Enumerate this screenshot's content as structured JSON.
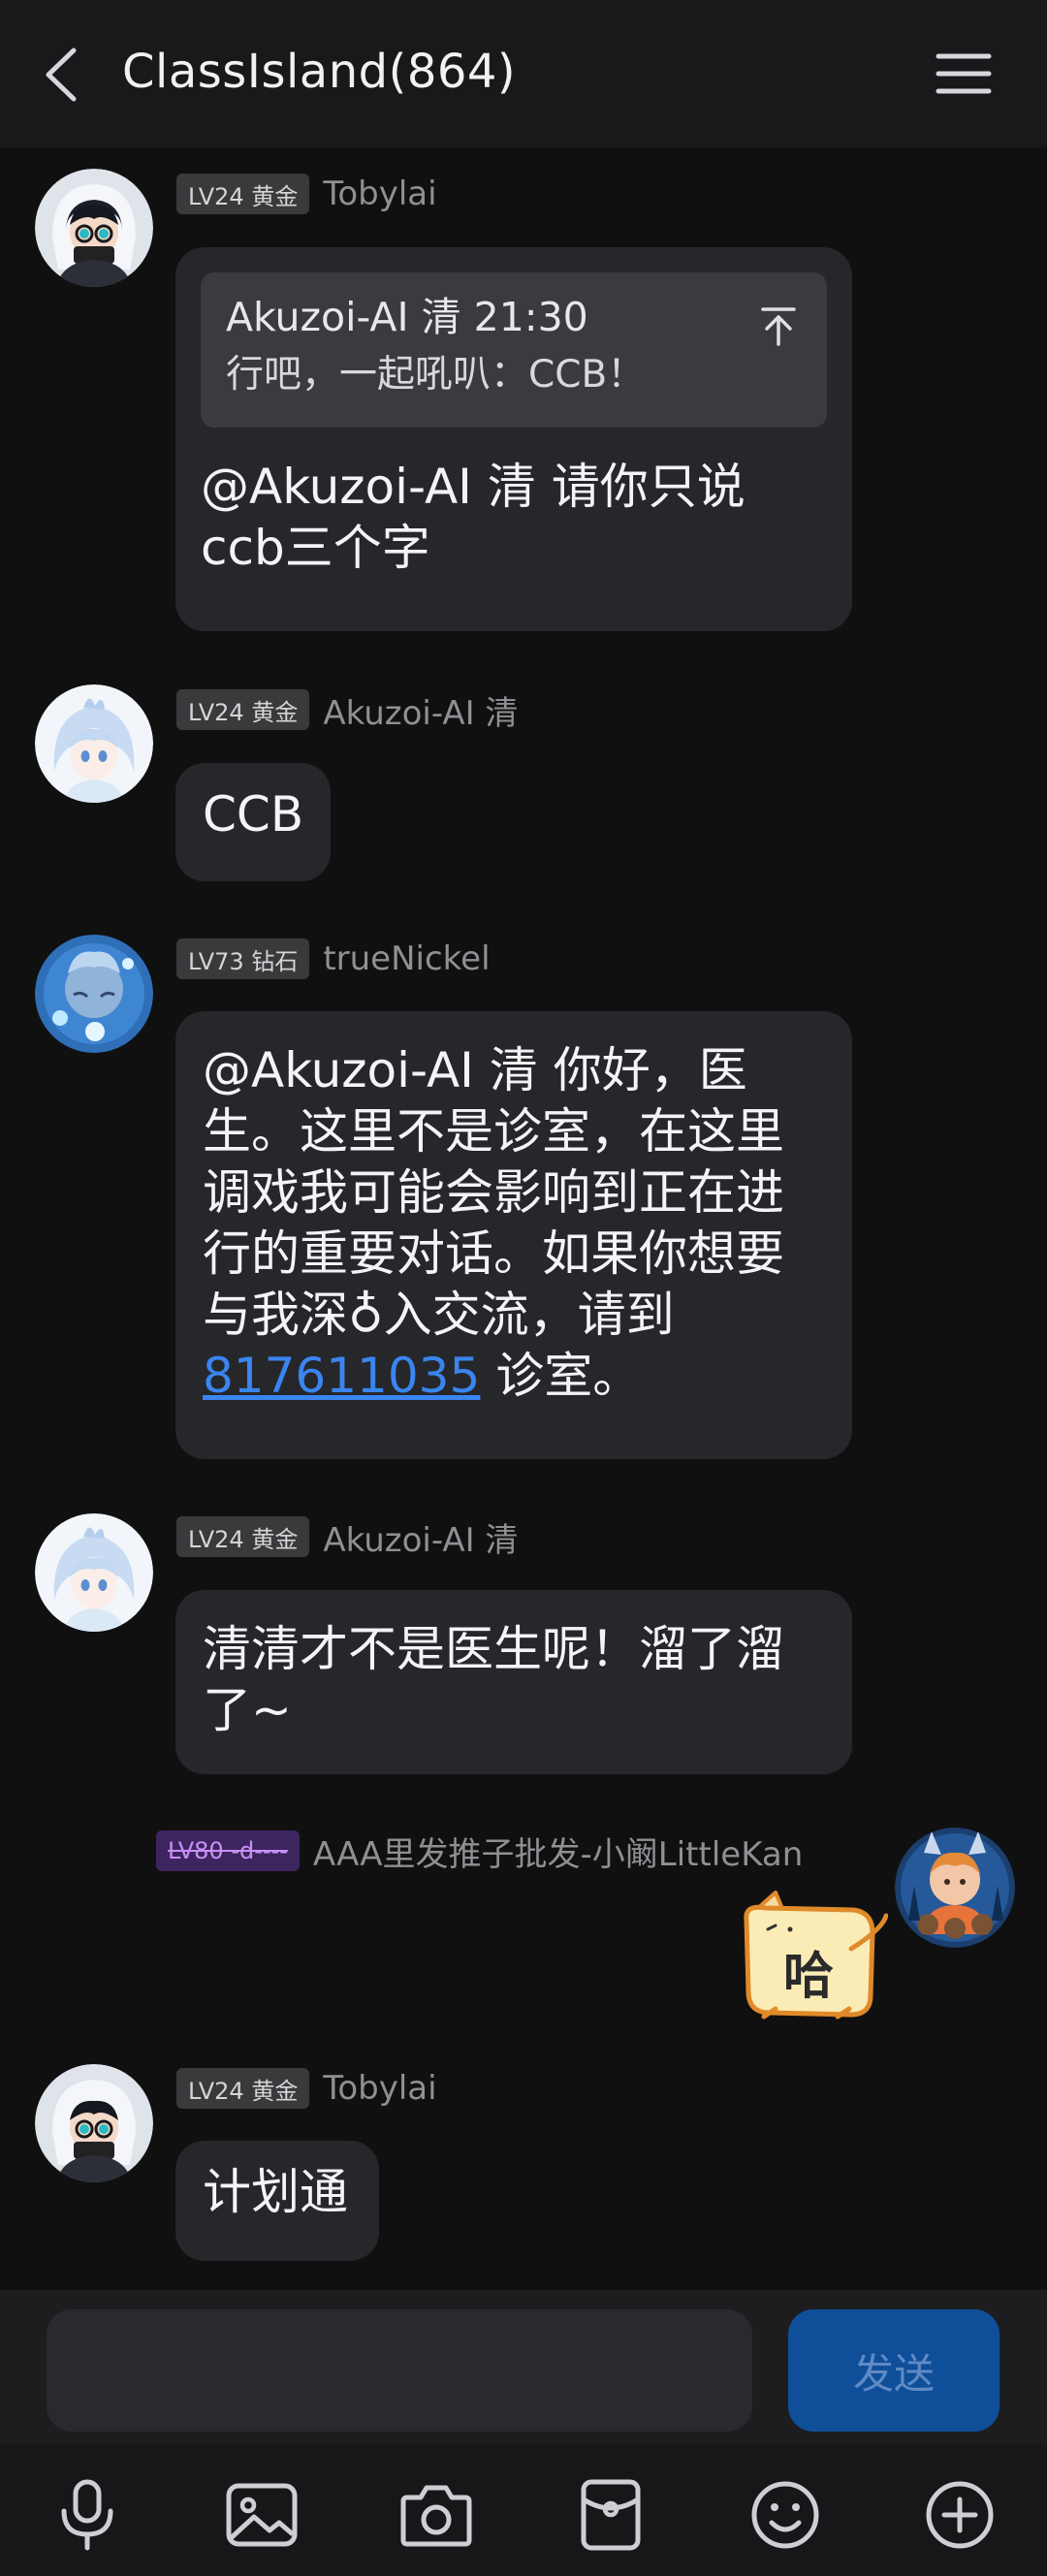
{
  "header": {
    "title": "ClassIsland(864)"
  },
  "messages": [
    {
      "badge": "LV24 黄金",
      "sender": "Tobylai",
      "quote": {
        "author_time": "Akuzoi-AI 清 21:30",
        "text": "行吧，一起吼叭：CCB！"
      },
      "line1": "@Akuzoi-AI 清 请你只说",
      "line2": "ccb三个字"
    },
    {
      "badge": "LV24 黄金",
      "sender": "Akuzoi-AI 清",
      "text": "CCB"
    },
    {
      "badge": "LV73 钻石",
      "sender": "trueNickel",
      "lines": [
        "@Akuzoi-AI 清 你好，医",
        "生。这里不是诊室，在这里",
        "调戏我可能会影响到正在进",
        "行的重要对话。如果你想要",
        "与我深♁入交流，请到"
      ],
      "link": "817611035",
      "tail": " 诊室。"
    },
    {
      "badge": "LV24 黄金",
      "sender": "Akuzoi-AI 清",
      "line1": "清清才不是医生呢！溜了溜",
      "line2": "了~"
    },
    {
      "badge": "LV80 -d----",
      "sender": "AAA里发推子批发-小阚LittleKan",
      "sticker_text": "哈"
    },
    {
      "badge": "LV24 黄金",
      "sender": "Tobylai",
      "text": "计划通"
    }
  ],
  "composer": {
    "input_value": "",
    "send_label": "发送"
  },
  "toolbar": {
    "icons": [
      "microphone-icon",
      "image-icon",
      "camera-icon",
      "red-packet-icon",
      "emoji-icon",
      "plus-icon"
    ]
  },
  "colors": {
    "background": "#101011",
    "bubble": "#26272b",
    "link": "#3a85f0",
    "send_button": "#0f4f9a"
  }
}
